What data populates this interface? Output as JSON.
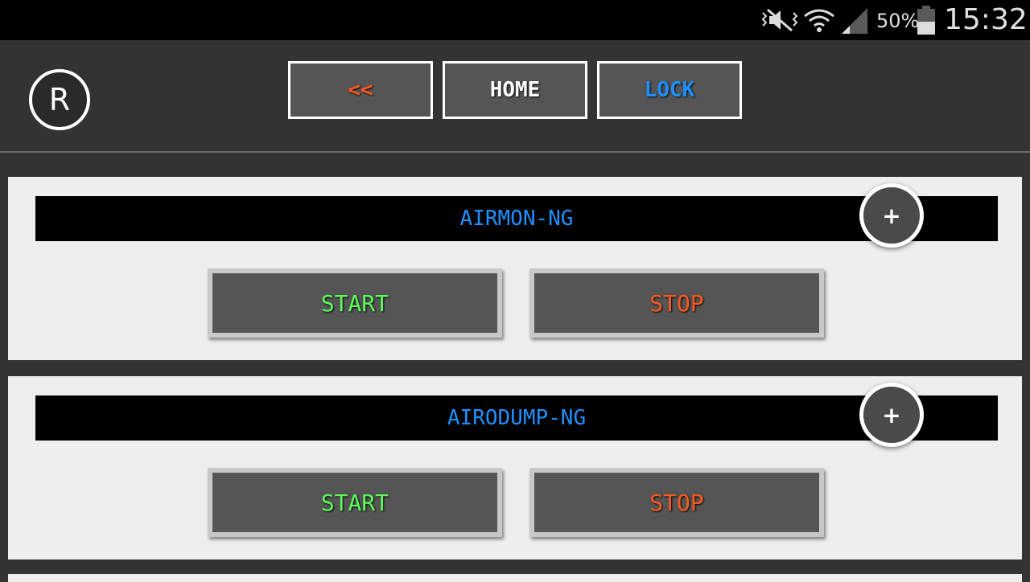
{
  "status_bar": {
    "battery_percent": "50%",
    "time": "15:32",
    "icons": [
      "mute-vibrate-icon",
      "wifi-icon",
      "cell-signal-icon",
      "battery-icon"
    ]
  },
  "toolbar": {
    "logo_letter": "R",
    "back_label": "<<",
    "home_label": "HOME",
    "lock_label": "LOCK"
  },
  "colors": {
    "back": "#ff5a1f",
    "home": "#ffffff",
    "lock": "#1e90ff",
    "title": "#1e90ff",
    "start": "#5cff5c",
    "stop": "#ff5a1f"
  },
  "cards": [
    {
      "title": "AIRMON-NG",
      "add_label": "+",
      "start_label": "START",
      "stop_label": "STOP"
    },
    {
      "title": "AIRODUMP-NG",
      "add_label": "+",
      "start_label": "START",
      "stop_label": "STOP"
    }
  ]
}
